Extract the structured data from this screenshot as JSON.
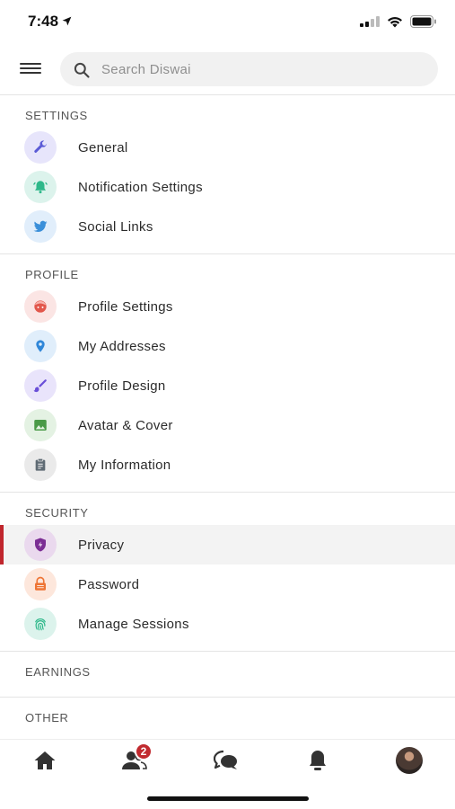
{
  "status_bar": {
    "time": "7:48"
  },
  "search": {
    "placeholder": "Search Diswai"
  },
  "sections": [
    {
      "title": "SETTINGS",
      "items": [
        {
          "label": "General",
          "icon": "wrench-icon"
        },
        {
          "label": "Notification Settings",
          "icon": "bell-icon"
        },
        {
          "label": "Social Links",
          "icon": "twitter-icon"
        }
      ]
    },
    {
      "title": "PROFILE",
      "items": [
        {
          "label": "Profile Settings",
          "icon": "face-icon"
        },
        {
          "label": "My Addresses",
          "icon": "map-pin-icon"
        },
        {
          "label": "Profile Design",
          "icon": "brush-icon"
        },
        {
          "label": "Avatar & Cover",
          "icon": "image-icon"
        },
        {
          "label": "My Information",
          "icon": "clipboard-icon"
        }
      ]
    },
    {
      "title": "SECURITY",
      "items": [
        {
          "label": "Privacy",
          "icon": "shield-icon",
          "active": true
        },
        {
          "label": "Password",
          "icon": "lock-icon"
        },
        {
          "label": "Manage Sessions",
          "icon": "fingerprint-icon"
        }
      ]
    },
    {
      "title": "EARNINGS",
      "items": []
    },
    {
      "title": "OTHER",
      "items": []
    }
  ],
  "bottom_nav": {
    "friends_badge": "2",
    "items": [
      "home-icon",
      "friends-icon",
      "chat-icon",
      "bell-icon",
      "avatar"
    ]
  },
  "colors": {
    "accent": "#c0262d",
    "wrench_bg": "#e7e5fb",
    "wrench": "#5b5bd6",
    "bell_bg": "#dcf3ec",
    "bell": "#2eb88a",
    "twitter_bg": "#e1eefb",
    "twitter": "#3a8fd9",
    "face_bg": "#fbe5e4",
    "face": "#e2574c",
    "pin_bg": "#e0eefb",
    "pin": "#2f86d8",
    "brush_bg": "#e9e4fb",
    "brush": "#6a4fd8",
    "image_bg": "#e4f2e3",
    "image": "#4a9a47",
    "clipboard_bg": "#eaeaea",
    "clipboard": "#5f6b74",
    "shield_bg": "#ead9ee",
    "shield": "#7b2d94",
    "lock_bg": "#fde7dc",
    "lock": "#ee7434",
    "fingerprint_bg": "#dcf3ec",
    "fingerprint": "#2eb88a"
  }
}
